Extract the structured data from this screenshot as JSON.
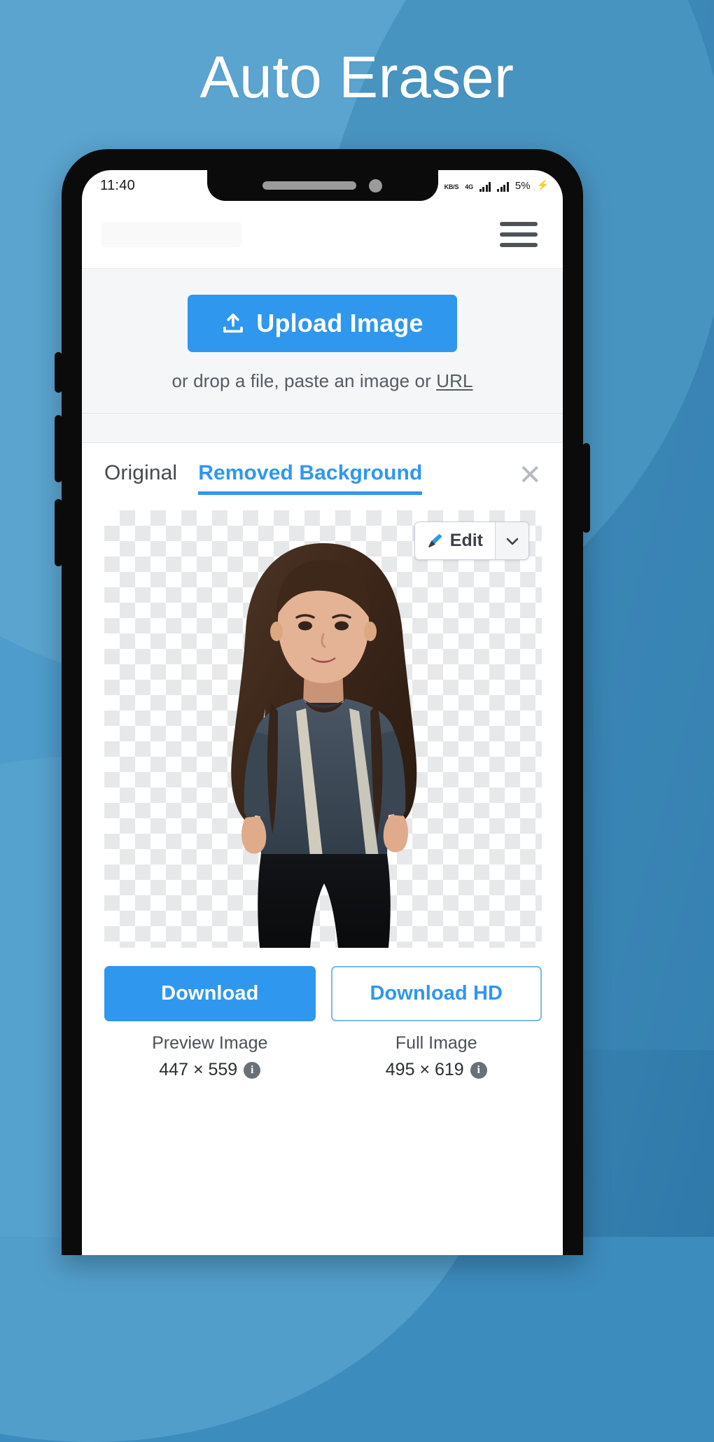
{
  "headline": "Auto Eraser",
  "colors": {
    "accent": "#2f97ee",
    "bg_blue": "#4e9ccb",
    "bg_blue_dark": "#2f79aa",
    "text_dark": "#2a2e33",
    "muted": "#565c63",
    "checker": "#e6e8ea"
  },
  "status_bar": {
    "time": "11:40",
    "net_speed_label": "KB/S",
    "network_type": "4G",
    "battery_percent": "5%",
    "charging_icon": "⚡",
    "signal_icon": "signal-bars-icon",
    "wifi_icon": "wifi-icon"
  },
  "header": {
    "menu_icon": "hamburger-menu-icon"
  },
  "upload": {
    "button_label": "Upload Image",
    "upload_icon": "upload-icon",
    "hint_prefix": "or drop a file, paste an image or ",
    "hint_link": "URL"
  },
  "result": {
    "tabs": [
      {
        "label": "Original",
        "active": false
      },
      {
        "label": "Removed Background",
        "active": true
      }
    ],
    "close_icon": "✕",
    "edit": {
      "label": "Edit",
      "brush_icon": "brush-icon",
      "caret_icon": "chevron-down-icon"
    }
  },
  "downloads": [
    {
      "button_label": "Download",
      "style": "primary",
      "caption": "Preview Image",
      "size": "447 × 559",
      "info_icon": "i"
    },
    {
      "button_label": "Download HD",
      "style": "outline",
      "caption": "Full Image",
      "size": "495 × 619",
      "info_icon": "i"
    }
  ]
}
